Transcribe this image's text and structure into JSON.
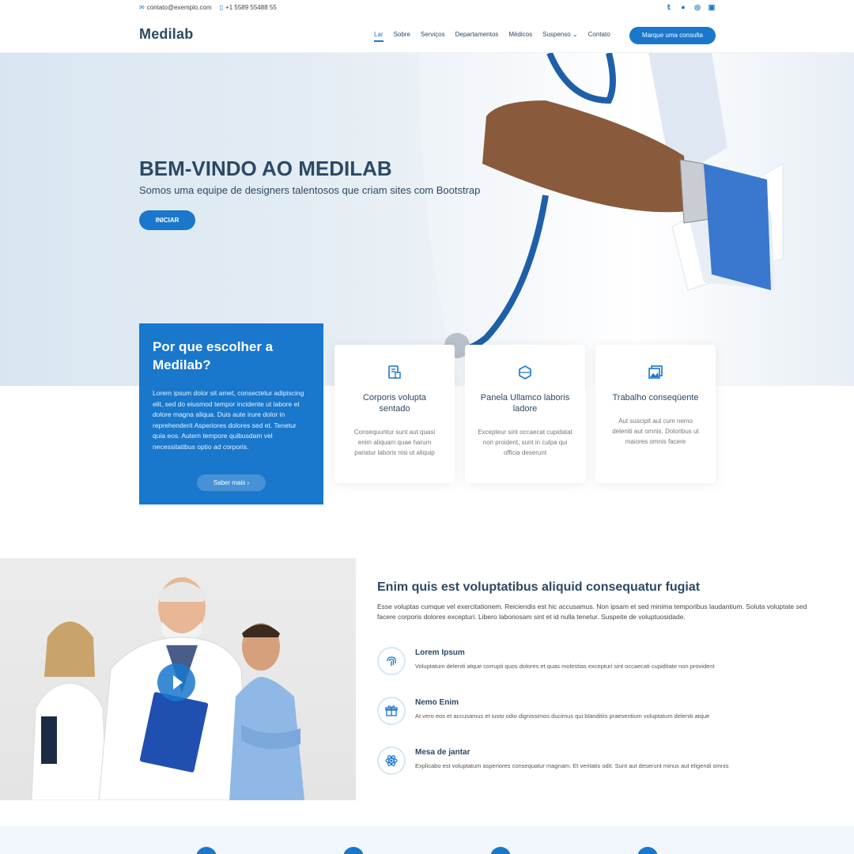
{
  "topbar": {
    "email": "contato@exemplo.com",
    "phone": "+1 5589 55488 55",
    "social": [
      "twitter-icon",
      "facebook-icon",
      "instagram-icon",
      "linkedin-icon"
    ]
  },
  "header": {
    "logo": "Medilab",
    "nav": [
      "Lar",
      "Sobre",
      "Serviços",
      "Departamentos",
      "Médicos",
      "Suspenso",
      "Contato"
    ],
    "cta": "Marque uma consulta"
  },
  "hero": {
    "title": "BEM-VINDO AO MEDILAB",
    "subtitle": "Somos uma equipe de designers talentosos que criam sites com Bootstrap",
    "button": "INICIAR"
  },
  "why": {
    "title": "Por que escolher a Medilab?",
    "text": "Lorem ipsum dolor sit amet, consectetur adipiscing elit, sed do eiusmod tempor incidente ut labore et dolore magna aliqua. Duis aute irure dolor in reprehenderit Asperiores dolores sed et. Tenetur quia eos. Autem tempore quibusdam vel necessitatibus optio ad corporis.",
    "more": "Saber mais ›"
  },
  "cards": [
    {
      "title": "Corporis volupta sentado",
      "text": "Consequuntur sunt aut quasi enim aliquam quae harum pariatur laboris nisi ut aliquip",
      "icon": "clipboard-icon"
    },
    {
      "title": "Panela Ullamco laboris ladore",
      "text": "Excepteur sint occaecat cupidatat non proident, sunt in culpa qui officia deserunt",
      "icon": "cube-icon"
    },
    {
      "title": "Trabalho conseqüente",
      "text": "Aut suscipit aut cum nemo deleniti aut omnis. Doloribus ut maiores omnis facere",
      "icon": "images-icon"
    }
  ],
  "about": {
    "title": "Enim quis est voluptatibus aliquid consequatur fugiat",
    "text": "Esse voluptas cumque vel exercitationem. Reiciendis est hic accusamus. Non ipsam et sed minima temporibus laudantium. Soluta voluptate sed facere corporis dolores excepturi. Libero laboriosam sint et id nulla tenetur. Suspeite de voluptuosidade.",
    "items": [
      {
        "title": "Lorem Ipsum",
        "text": "Voluptatum deleniti atque corrupti quos dolores et quas molestias excepturi sint occaecati cupiditate non provident",
        "icon": "fingerprint-icon"
      },
      {
        "title": "Nemo Enim",
        "text": "At vero eos et accusamus et iusto odio dignissimos ducimus qui blanditiis praesentium voluptatum deleniti atque",
        "icon": "gift-icon"
      },
      {
        "title": "Mesa de jantar",
        "text": "Explicabo est voluptatum asperiores consequatur magnam. Et veritatis odit. Sunt aut deserunt minus aut eligendi omnis",
        "icon": "atom-icon"
      }
    ]
  },
  "colors": {
    "accent": "#1977cc",
    "heading": "#2c4964"
  }
}
